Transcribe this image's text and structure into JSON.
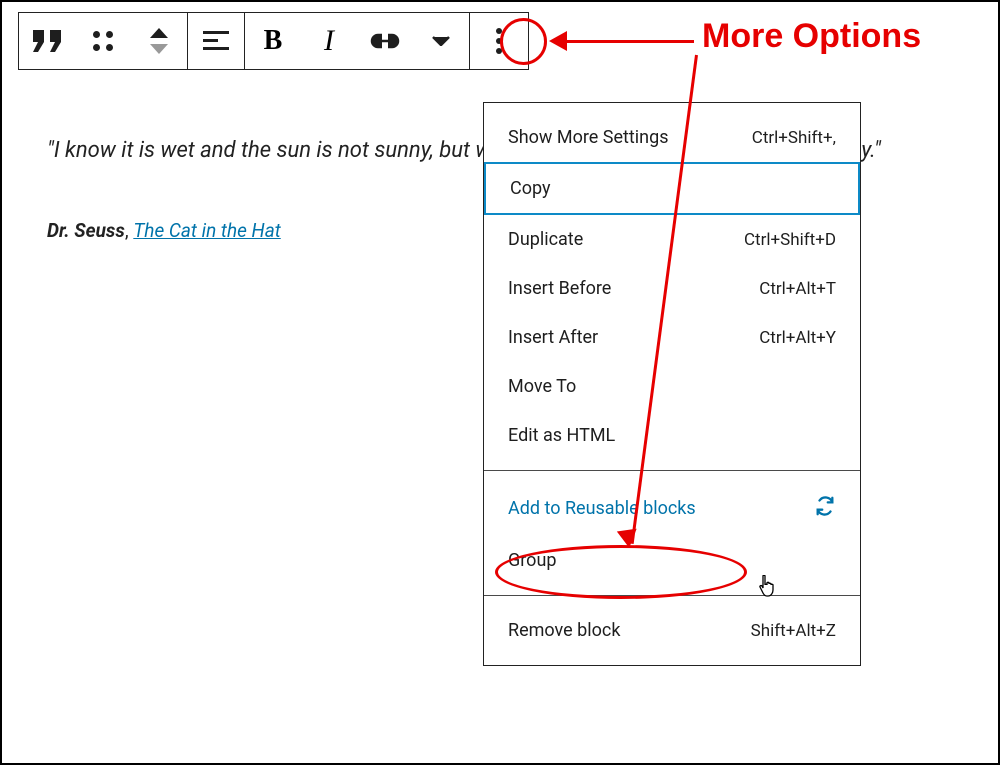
{
  "annotation": {
    "more_options": "More Options"
  },
  "quote": {
    "text": "\"I know it is wet and the sun is not sunny, but we can have lots of good fun that is funny.\"",
    "author": "Dr. Seuss",
    "sep": ", ",
    "source": "The Cat in the Hat"
  },
  "menu": {
    "section1": [
      {
        "label": "Show More Settings",
        "shortcut": "Ctrl+Shift+,"
      },
      {
        "label": "Copy",
        "shortcut": ""
      },
      {
        "label": "Duplicate",
        "shortcut": "Ctrl+Shift+D"
      },
      {
        "label": "Insert Before",
        "shortcut": "Ctrl+Alt+T"
      },
      {
        "label": "Insert After",
        "shortcut": "Ctrl+Alt+Y"
      },
      {
        "label": "Move To",
        "shortcut": ""
      },
      {
        "label": "Edit as HTML",
        "shortcut": ""
      }
    ],
    "section2": [
      {
        "label": "Add to Reusable blocks",
        "shortcut": ""
      },
      {
        "label": "Group",
        "shortcut": ""
      }
    ],
    "section3": [
      {
        "label": "Remove block",
        "shortcut": "Shift+Alt+Z"
      }
    ]
  }
}
